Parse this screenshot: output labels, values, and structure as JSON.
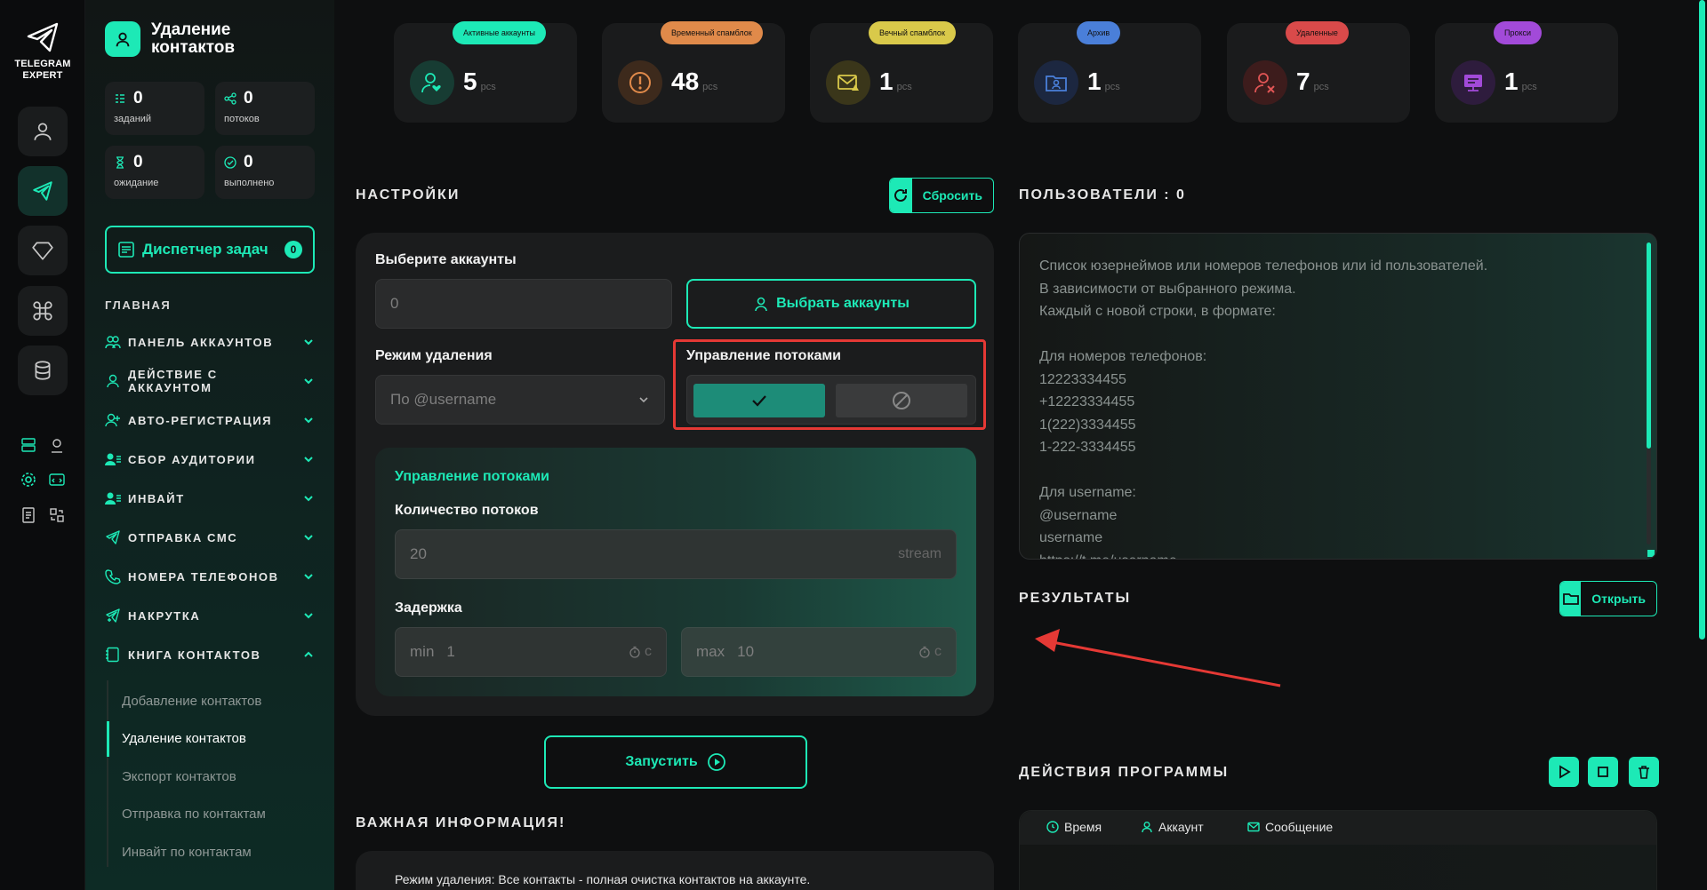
{
  "app": {
    "brand": "TELEGRAM EXPERT",
    "page_title": "Удаление контактов"
  },
  "stats": [
    {
      "value": "0",
      "label": "заданий",
      "icon": "tasks-icon"
    },
    {
      "value": "0",
      "label": "потоков",
      "icon": "threads-icon"
    },
    {
      "value": "0",
      "label": "ожидание",
      "icon": "hourglass-icon"
    },
    {
      "value": "0",
      "label": "выполнено",
      "icon": "check-circle-icon"
    }
  ],
  "dispatcher": {
    "label": "Диспетчер задач",
    "badge": "0"
  },
  "sidebar": {
    "section": "ГЛАВНАЯ",
    "items": [
      {
        "label": "ПАНЕЛЬ АККАУНТОВ",
        "expanded": false
      },
      {
        "label": "ДЕЙСТВИЕ С АККАУНТОМ",
        "expanded": false
      },
      {
        "label": "АВТО-РЕГИСТРАЦИЯ",
        "expanded": false
      },
      {
        "label": "СБОР АУДИТОРИИ",
        "expanded": false
      },
      {
        "label": "ИНВАЙТ",
        "expanded": false
      },
      {
        "label": "ОТПРАВКА СМС",
        "expanded": false
      },
      {
        "label": "НОМЕРА ТЕЛЕФОНОВ",
        "expanded": false
      },
      {
        "label": "НАКРУТКА",
        "expanded": false
      },
      {
        "label": "КНИГА КОНТАКТОВ",
        "expanded": true
      }
    ],
    "sub_items": [
      {
        "label": "Добавление контактов",
        "active": false
      },
      {
        "label": "Удаление контактов",
        "active": true
      },
      {
        "label": "Экспорт контактов",
        "active": false
      },
      {
        "label": "Отправка по контактам",
        "active": false
      },
      {
        "label": "Инвайт по контактам",
        "active": false
      }
    ]
  },
  "account_cards": [
    {
      "tag": "Активные аккаунты",
      "value": "5",
      "unit": "pcs",
      "color": "#1de9b6"
    },
    {
      "tag": "Временный спамблок",
      "value": "48",
      "unit": "pcs",
      "color": "#e08a4a"
    },
    {
      "tag": "Вечный спамблок",
      "value": "1",
      "unit": "pcs",
      "color": "#d9c94a"
    },
    {
      "tag": "Архив",
      "value": "1",
      "unit": "pcs",
      "color": "#4a7fd9"
    },
    {
      "tag": "Удаленные",
      "value": "7",
      "unit": "pcs",
      "color": "#d94a4a"
    },
    {
      "tag": "Прокси",
      "value": "1",
      "unit": "pcs",
      "color": "#a24ad9"
    }
  ],
  "settings": {
    "heading": "НАСТРОЙКИ",
    "reset_label": "Сбросить",
    "accounts_label": "Выберите аккаунты",
    "accounts_value": "0",
    "select_accounts_label": "Выбрать аккаунты",
    "mode_label": "Режим удаления",
    "mode_value": "По @username",
    "threads_toggle_label": "Управление потоками",
    "threads_panel_title": "Управление потоками",
    "threads_count_label": "Количество потоков",
    "threads_count_value": "20",
    "threads_count_suffix": "stream",
    "delay_label": "Задержка",
    "delay_min_prefix": "min",
    "delay_min_value": "1",
    "delay_max_prefix": "max",
    "delay_max_value": "10",
    "delay_unit": "с"
  },
  "run_label": "Запустить",
  "info": {
    "heading": "ВАЖНАЯ ИНФОРМАЦИЯ!",
    "text": "Режим удаления: Все контакты - полная очистка контактов на аккаунте."
  },
  "users": {
    "heading": "ПОЛЬЗОВАТЕЛИ : 0",
    "placeholder": "Список юзернеймов или номеров телефонов или id пользователей.\nВ зависимости от выбранного режима.\nКаждый с новой строки, в формате:\n\nДля номеров телефонов:\n12223334455\n+12223334455\n1(222)3334455\n1-222-3334455\n\nДля username:\n@username\nusername\nhttps://t.me/username"
  },
  "results": {
    "heading": "РЕЗУЛЬТАТЫ",
    "open_label": "Открыть"
  },
  "actions": {
    "heading": "ДЕЙСТВИЯ ПРОГРАММЫ",
    "columns": [
      "Время",
      "Аккаунт",
      "Сообщение"
    ]
  },
  "colors": {
    "accent": "#1de9b6",
    "highlight": "#e53935"
  }
}
